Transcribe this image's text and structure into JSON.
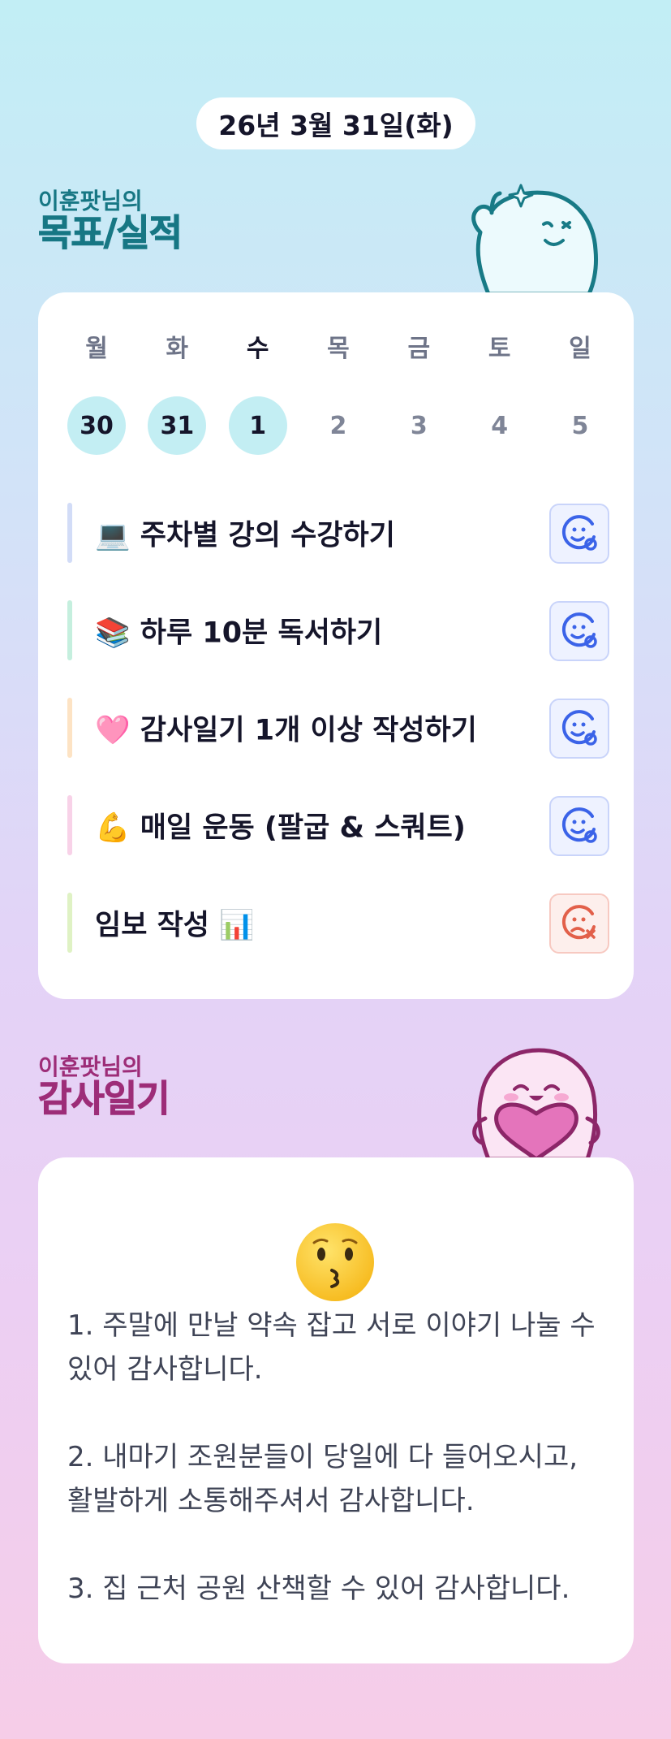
{
  "header": {
    "date": "26년 3월 31일(화)"
  },
  "goals_section": {
    "owner": "이훈팟님의",
    "title": "목표/실적",
    "week": [
      {
        "label": "월",
        "num": "30",
        "state": "done"
      },
      {
        "label": "화",
        "num": "31",
        "state": "done"
      },
      {
        "label": "수",
        "num": "1",
        "state": "done-today"
      },
      {
        "label": "목",
        "num": "2",
        "state": "none"
      },
      {
        "label": "금",
        "num": "3",
        "state": "none"
      },
      {
        "label": "토",
        "num": "4",
        "state": "none"
      },
      {
        "label": "일",
        "num": "5",
        "state": "none"
      }
    ],
    "goals": [
      {
        "text": "💻 주차별 강의 수강하기",
        "bar_color": "#d2dcf7",
        "status": "success",
        "status_icon": "smile-check-icon"
      },
      {
        "text": "📚 하루 10분 독서하기",
        "bar_color": "#c5efde",
        "status": "success",
        "status_icon": "smile-check-icon"
      },
      {
        "text": "🩷 감사일기 1개 이상 작성하기",
        "bar_color": "#fde3c4",
        "status": "success",
        "status_icon": "smile-check-icon"
      },
      {
        "text": "💪 매일 운동 (팔굽 & 스쿼트)",
        "bar_color": "#f8d2e8",
        "status": "success",
        "status_icon": "smile-check-icon"
      },
      {
        "text": "임보 작성 📊",
        "bar_color": "#dff2c4",
        "status": "fail",
        "status_icon": "sad-x-icon"
      }
    ]
  },
  "thanks_section": {
    "owner": "이훈팟님의",
    "title": "감사일기",
    "mood_icon": "kissing-face-emoji",
    "entries": [
      "1. 주말에 만날 약속 잡고 서로 이야기 나눌 수 있어 감사합니다.",
      "2. 내마기 조원분들이 당일에 다 들어오시고, 활발하게 소통해주셔서 감사합니다.",
      "3. 집 근처 공원 산책할 수 있어 감사합니다."
    ]
  },
  "colors": {
    "goals_heading": "#177784",
    "thanks_heading": "#9d2d78",
    "done_circle": "#c3eef3",
    "success_icon": "#3b63e8",
    "fail_icon": "#e2604a"
  }
}
